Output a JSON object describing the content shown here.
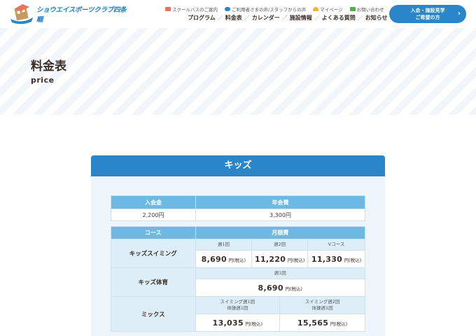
{
  "header": {
    "logo_text": "ショウエイスポーツクラブ四条畷",
    "util_links": [
      {
        "label": "スクールバスのご案内",
        "color": "#e8735a"
      },
      {
        "label": "ご利用者さまの声/スタッフからの声",
        "color": "#2a86c9"
      },
      {
        "label": "マイページ",
        "color": "#f2b33d"
      },
      {
        "label": "お問い合わせ",
        "color": "#4caf50"
      }
    ],
    "nav": [
      "プログラム",
      "料金表",
      "カレンダー",
      "施設情報",
      "よくある質問",
      "お知らせ"
    ],
    "nav_sep": "／",
    "cta_line1": "入会・施設見学",
    "cta_line2": "ご希望の方",
    "cta_arrow": "›"
  },
  "hero": {
    "title": "料金表",
    "subtitle": "price"
  },
  "section": {
    "title": "キッズ",
    "color": "#2a86c9"
  },
  "fees": {
    "headers": [
      "入会金",
      "年会費"
    ],
    "values": [
      "2,200円",
      "3,300円"
    ]
  },
  "monthly": {
    "course_header": "コース",
    "fee_header": "月額費",
    "unit": "円(税込)",
    "swim": {
      "name": "キッズスイミング",
      "plans": [
        {
          "label": "週1回",
          "price": "8,690"
        },
        {
          "label": "週2回",
          "price": "11,220"
        },
        {
          "label": "Vコース",
          "price": "11,330"
        }
      ]
    },
    "gym": {
      "name": "キッズ体育",
      "label": "週1回",
      "price": "8,690"
    },
    "mix": {
      "name": "ミックス",
      "plans": [
        {
          "label1": "スイミング週1回",
          "label2": "体操週1回",
          "price": "13,035"
        },
        {
          "label1": "スイミング週2回",
          "label2": "体操週1回",
          "price": "15,565"
        }
      ]
    }
  }
}
